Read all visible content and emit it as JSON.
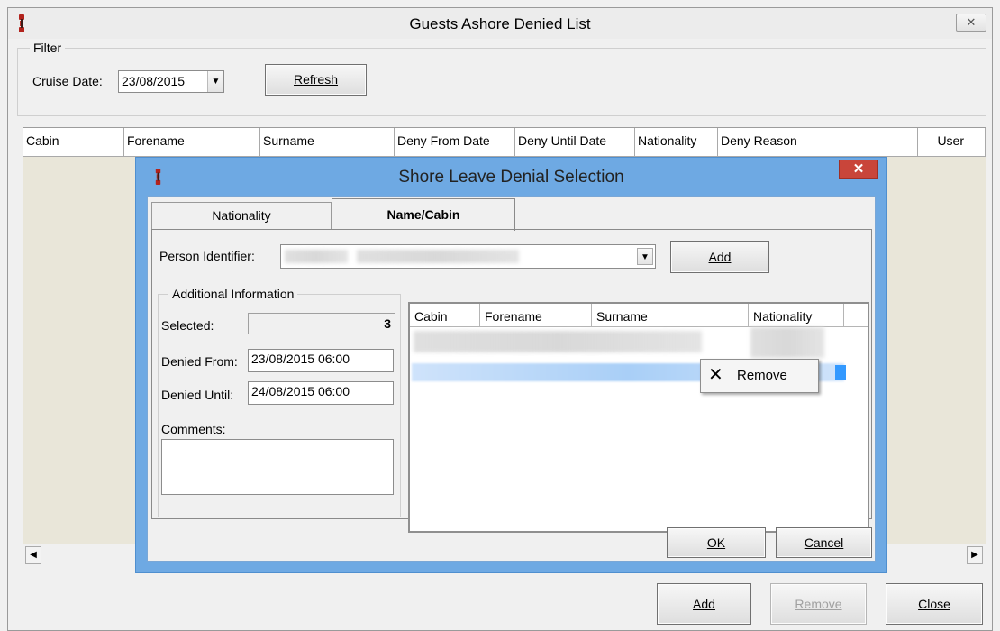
{
  "main": {
    "title": "Guests Ashore Denied List",
    "close_glyph": "✕",
    "filter": {
      "caption": "Filter",
      "cruise_date_label": "Cruise Date:",
      "cruise_date_value": "23/08/2015",
      "refresh_label": "Refresh"
    },
    "columns": [
      "Cabin",
      "Forename",
      "Surname",
      "Deny From Date",
      "Deny Until Date",
      "Nationality",
      "Deny Reason",
      "User"
    ],
    "buttons": {
      "add": "Add",
      "remove": "Remove",
      "close": "Close"
    }
  },
  "dialog": {
    "title": "Shore Leave Denial Selection",
    "close_glyph": "✕",
    "tabs": [
      "Nationality",
      "Name/Cabin"
    ],
    "active_tab": "Name/Cabin",
    "person_identifier_label": "Person Identifier:",
    "add_label": "Add",
    "additional_info": {
      "caption": "Additional Information",
      "selected_label": "Selected:",
      "selected_value": "3",
      "denied_from_label": "Denied From:",
      "denied_from_value": "23/08/2015 06:00",
      "denied_until_label": "Denied Until:",
      "denied_until_value": "24/08/2015 06:00",
      "comments_label": "Comments:"
    },
    "list_columns": [
      "Cabin",
      "Forename",
      "Surname",
      "Nationality"
    ],
    "context_menu": {
      "remove_label": "Remove"
    },
    "ok_label": "OK",
    "cancel_label": "Cancel"
  },
  "colors": {
    "dialog_frame": "#6ea9e3",
    "close_red": "#c9453a",
    "grid_background": "#e9e6d9",
    "selection_blue": "#3399ff"
  }
}
